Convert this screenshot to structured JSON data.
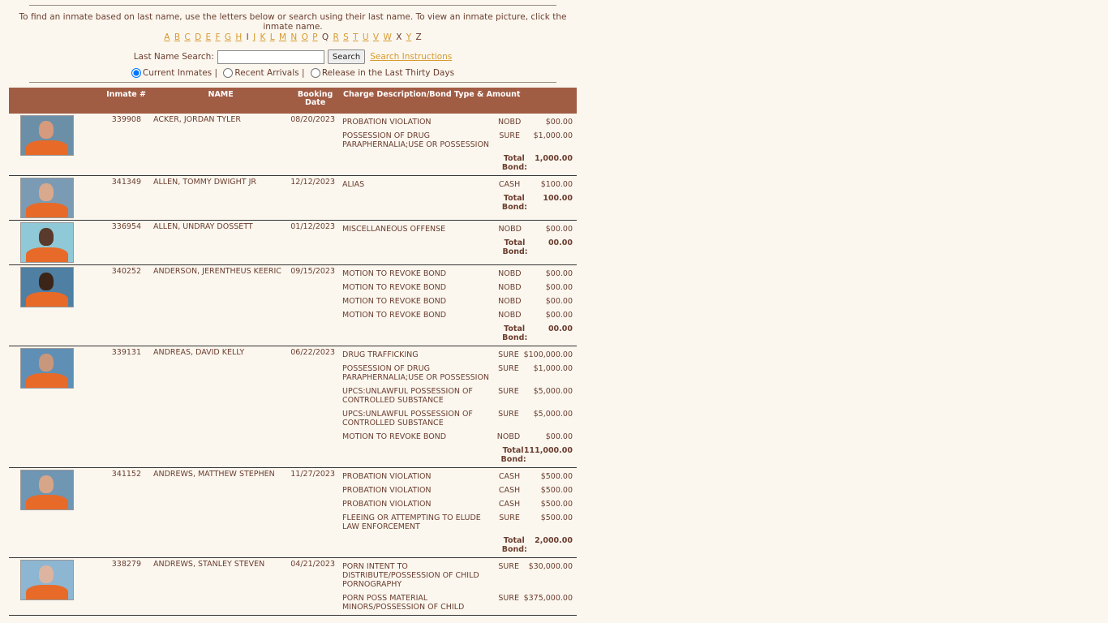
{
  "intro_text": "To find an inmate based on last name, use the letters below or search using their last name.  To view an inmate picture, click the inmate name.",
  "letters": [
    {
      "l": "A",
      "link": true
    },
    {
      "l": "B",
      "link": true
    },
    {
      "l": "C",
      "link": true
    },
    {
      "l": "D",
      "link": true
    },
    {
      "l": "E",
      "link": true
    },
    {
      "l": "F",
      "link": true
    },
    {
      "l": "G",
      "link": true
    },
    {
      "l": "H",
      "link": true
    },
    {
      "l": "I",
      "link": false
    },
    {
      "l": "J",
      "link": true
    },
    {
      "l": "K",
      "link": true
    },
    {
      "l": "L",
      "link": true
    },
    {
      "l": "M",
      "link": true
    },
    {
      "l": "N",
      "link": true
    },
    {
      "l": "O",
      "link": true
    },
    {
      "l": "P",
      "link": true
    },
    {
      "l": "Q",
      "link": false
    },
    {
      "l": "R",
      "link": true
    },
    {
      "l": "S",
      "link": true
    },
    {
      "l": "T",
      "link": true
    },
    {
      "l": "U",
      "link": true
    },
    {
      "l": "V",
      "link": true
    },
    {
      "l": "W",
      "link": true
    },
    {
      "l": "X",
      "link": false
    },
    {
      "l": "Y",
      "link": true
    },
    {
      "l": "Z",
      "link": false
    }
  ],
  "search": {
    "label": "Last Name Search:",
    "value": "",
    "button": "Search",
    "instructions_link": "Search Instructions"
  },
  "filters": {
    "current": "Current Inmates |",
    "recent": "Recent Arrivals |",
    "released": "Release in the Last Thirty Days",
    "selected": "current"
  },
  "table": {
    "headers": {
      "inmate_num": "Inmate #",
      "name": "NAME",
      "booking_date": "Booking Date",
      "charges": "Charge Description/Bond Type & Amount"
    },
    "total_label": "Total Bond:",
    "inmates": [
      {
        "num": "339908",
        "name": "ACKER, JORDAN TYLER",
        "date": "08/20/2023",
        "bg": "#6c8fa8",
        "skin": "#d79a7c",
        "charges": [
          {
            "d": "PROBATION VIOLATION",
            "t": "NOBD",
            "a": "$00.00"
          },
          {
            "d": "POSSESSION OF DRUG PARAPHERNALIA;USE OR POSSESSION",
            "t": "SURE",
            "a": "$1,000.00"
          }
        ],
        "total": "1,000.00"
      },
      {
        "num": "341349",
        "name": "ALLEN, TOMMY DWIGHT JR",
        "date": "12/12/2023",
        "bg": "#7b9bb5",
        "skin": "#d9a98e",
        "charges": [
          {
            "d": "ALIAS",
            "t": "CASH",
            "a": "$100.00"
          }
        ],
        "total": "100.00"
      },
      {
        "num": "336954",
        "name": "ALLEN, UNDRAY DOSSETT",
        "date": "01/12/2023",
        "bg": "#8fc8d6",
        "skin": "#5a3a2c",
        "charges": [
          {
            "d": "MISCELLANEOUS OFFENSE",
            "t": "NOBD",
            "a": "$00.00"
          }
        ],
        "total": "00.00"
      },
      {
        "num": "340252",
        "name": "ANDERSON, JERENTHEUS KEERIC",
        "date": "09/15/2023",
        "bg": "#4f7fa3",
        "skin": "#3b2418",
        "charges": [
          {
            "d": "MOTION TO REVOKE BOND",
            "t": "NOBD",
            "a": "$00.00"
          },
          {
            "d": "MOTION TO REVOKE BOND",
            "t": "NOBD",
            "a": "$00.00"
          },
          {
            "d": "MOTION TO REVOKE BOND",
            "t": "NOBD",
            "a": "$00.00"
          },
          {
            "d": "MOTION TO REVOKE BOND",
            "t": "NOBD",
            "a": "$00.00"
          }
        ],
        "total": "00.00"
      },
      {
        "num": "339131",
        "name": "ANDREAS, DAVID KELLY",
        "date": "06/22/2023",
        "bg": "#5f8fb4",
        "skin": "#c9977c",
        "charges": [
          {
            "d": "DRUG TRAFFICKING",
            "t": "SURE",
            "a": "$100,000.00"
          },
          {
            "d": "POSSESSION OF DRUG PARAPHERNALIA;USE OR POSSESSION",
            "t": "SURE",
            "a": "$1,000.00"
          },
          {
            "d": "UPCS:UNLAWFUL POSSESSION OF CONTROLLED SUBSTANCE",
            "t": "SURE",
            "a": "$5,000.00"
          },
          {
            "d": "UPCS:UNLAWFUL POSSESSION OF CONTROLLED SUBSTANCE",
            "t": "SURE",
            "a": "$5,000.00"
          },
          {
            "d": "MOTION TO REVOKE BOND",
            "t": "NOBD",
            "a": "$00.00"
          }
        ],
        "total": "111,000.00"
      },
      {
        "num": "341152",
        "name": "ANDREWS, MATTHEW STEPHEN",
        "date": "11/27/2023",
        "bg": "#6f96b3",
        "skin": "#d7a588",
        "charges": [
          {
            "d": "PROBATION VIOLATION",
            "t": "CASH",
            "a": "$500.00"
          },
          {
            "d": "PROBATION VIOLATION",
            "t": "CASH",
            "a": "$500.00"
          },
          {
            "d": "PROBATION VIOLATION",
            "t": "CASH",
            "a": "$500.00"
          },
          {
            "d": "FLEEING OR ATTEMPTING TO ELUDE LAW ENFORCEMENT",
            "t": "SURE",
            "a": "$500.00"
          }
        ],
        "total": "2,000.00"
      },
      {
        "num": "338279",
        "name": "ANDREWS, STANLEY STEVEN",
        "date": "04/21/2023",
        "bg": "#8cb6d2",
        "skin": "#dcb4a0",
        "charges": [
          {
            "d": "PORN INTENT TO DISTRIBUTE/POSSESSION OF CHILD PORNOGRAPHY",
            "t": "SURE",
            "a": "$30,000.00"
          },
          {
            "d": "PORN POSS MATERIAL MINORS/POSSESSION OF CHILD",
            "t": "SURE",
            "a": "$375,000.00"
          }
        ],
        "total": ""
      }
    ]
  }
}
